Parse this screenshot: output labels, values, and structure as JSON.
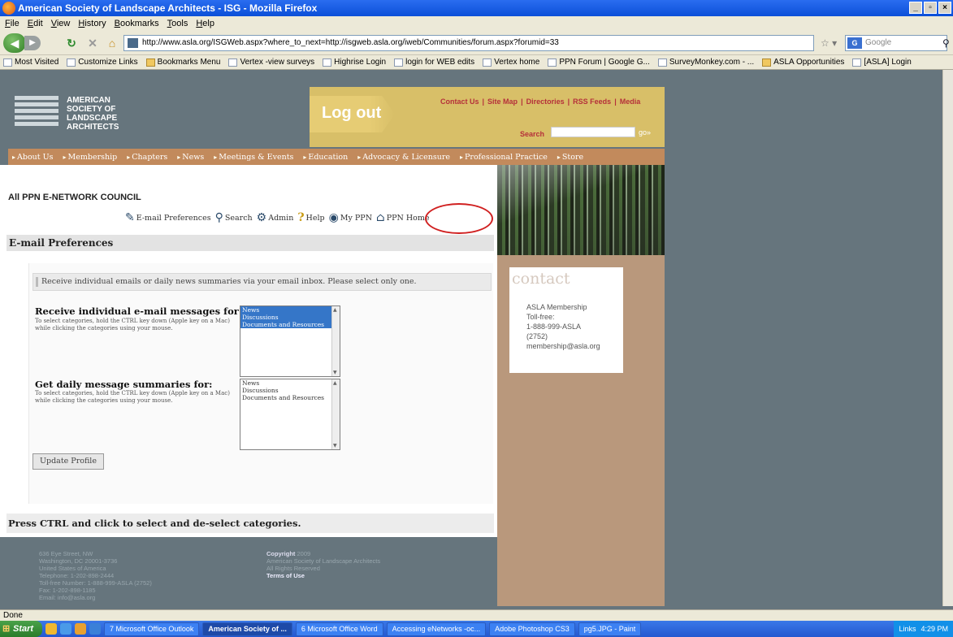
{
  "browser": {
    "title": "American Society of Landscape Architects - ISG - Mozilla Firefox",
    "menu": [
      "File",
      "Edit",
      "View",
      "History",
      "Bookmarks",
      "Tools",
      "Help"
    ],
    "url": "http://www.asla.org/ISGWeb.aspx?where_to_next=http://isgweb.asla.org/iweb/Communities/forum.aspx?forumid=33",
    "search_placeholder": "Google",
    "bookmarks": [
      "Most Visited",
      "Customize Links",
      "Bookmarks Menu",
      "Vertex -view surveys",
      "Highrise Login",
      "login for WEB edits",
      "Vertex home",
      "PPN Forum | Google G...",
      "SurveyMonkey.com - ...",
      "ASLA Opportunities",
      "[ASLA] Login"
    ],
    "status": "Done"
  },
  "site": {
    "org_lines": [
      "AMERICAN",
      "SOCIETY OF",
      "LANDSCAPE",
      "ARCHITECTS"
    ],
    "logout": "Log out",
    "top_links": [
      "Contact Us",
      "|",
      "Site Map",
      "|",
      "Directories",
      "|",
      "RSS Feeds",
      "|",
      "Media"
    ],
    "search_label": "Search",
    "go": "go»",
    "nav": [
      "About Us",
      "Membership",
      "Chapters",
      "News",
      "Meetings & Events",
      "Education",
      "Advocacy & Licensure",
      "Professional Practice",
      "Store"
    ]
  },
  "page": {
    "council": "All PPN E-NETWORK COUNCIL",
    "toolbar": {
      "email_prefs": "E-mail Preferences",
      "search": "Search",
      "admin": "Admin",
      "help": "Help",
      "my_ppn": "My PPN",
      "ppn_home": "PPN Home"
    },
    "section_title": "E-mail Preferences",
    "notice": "Receive individual emails or daily news summaries via your email inbox. Please select only one.",
    "individual": {
      "title": "Receive individual e-mail messages for:",
      "desc": "To select categories, hold the CTRL key down (Apple key on a Mac) while clicking the categories using your mouse.",
      "options": [
        "News",
        "Discussions",
        "Documents and Resources"
      ]
    },
    "daily": {
      "title": "Get daily message summaries for:",
      "desc": "To select categories, hold the CTRL key down (Apple key on a Mac) while clicking the categories using your mouse.",
      "options": [
        "News",
        "Discussions",
        "Documents and Resources"
      ]
    },
    "update_button": "Update Profile",
    "ctrl_note": "Press CTRL and click to select and de-select categories."
  },
  "contact": {
    "title": "contact",
    "lines": "ASLA Membership\nToll-free:\n1-888-999-ASLA\n(2752)\nmembership@asla.org"
  },
  "footer": {
    "address": "636 Eye Street, NW\nWashington, DC 20001-3736\nUnited States of America\nTelephone: 1-202-898-2444\nToll-free Number: 1-888-999-ASLA (2752)\nFax: 1-202-898-1185\nEmail: info@asla.org",
    "copyright_label": "Copyright",
    "copyright_year": "2009",
    "copyright_org": "American Society of Landscape Architects",
    "rights": "All Rights Reserved",
    "terms": "Terms of Use"
  },
  "taskbar": {
    "start": "Start",
    "tasks": [
      "7 Microsoft Office Outlook",
      "American Society of ...",
      "6 Microsoft Office Word",
      "Accessing eNetworks -oc...",
      "Adobe Photoshop CS3",
      "pg5.JPG - Paint"
    ],
    "links": "Links",
    "time": "4:29 PM"
  },
  "colors": {
    "page_bg": "#66757d",
    "nav_bar": "#c28a5c",
    "logout_box": "#d8bf68",
    "right_column": "#b9987c",
    "highlight_ring": "#d02020",
    "selected_option": "#3576c8"
  }
}
